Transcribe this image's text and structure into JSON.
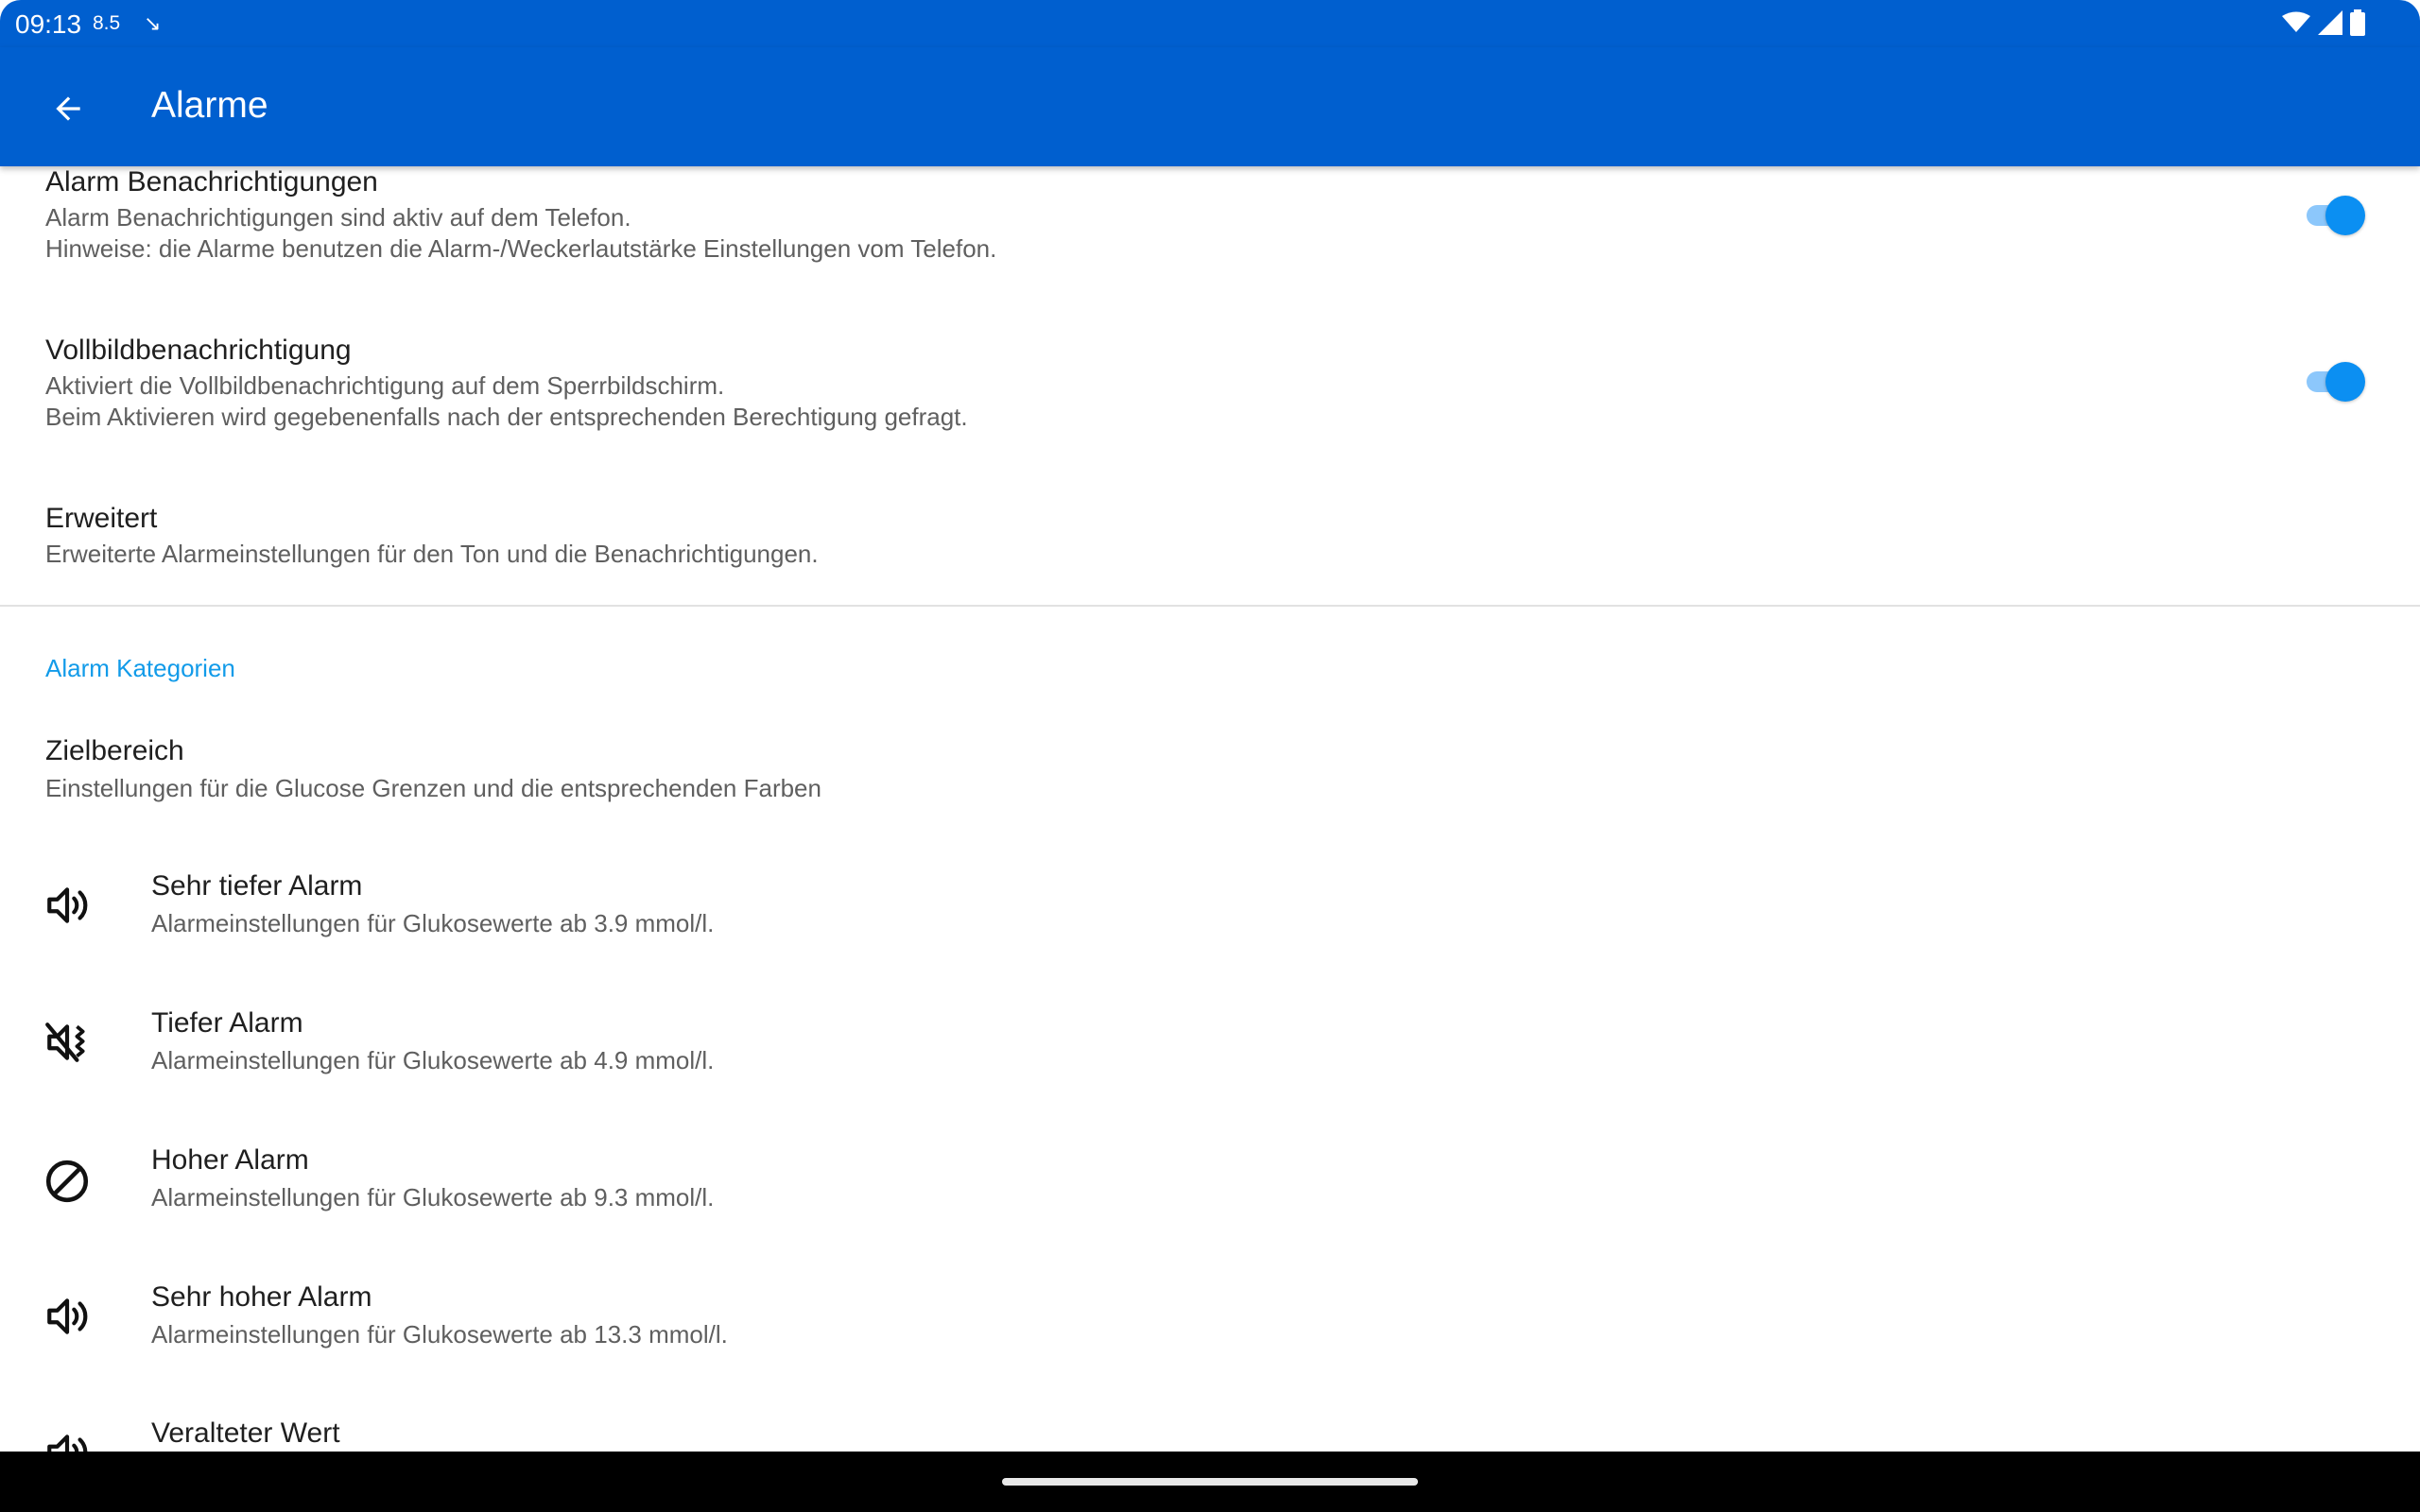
{
  "status_bar": {
    "time": "09:13",
    "value": "8.5",
    "trend_arrow": "↘",
    "icons": [
      "wifi-icon",
      "cellular-signal-icon",
      "battery-icon"
    ]
  },
  "app_bar": {
    "back_icon": "arrow-left-icon",
    "title": "Alarme"
  },
  "settings": {
    "alarm_notifications": {
      "title": "Alarm Benachrichtigungen",
      "summary_line1": "Alarm Benachrichtigungen sind aktiv auf dem Telefon.",
      "summary_line2": "Hinweise: die Alarme benutzen die Alarm-/Weckerlautstärke Einstellungen vom Telefon.",
      "enabled": true
    },
    "fullscreen_notification": {
      "title": "Vollbildbenachrichtigung",
      "summary_line1": "Aktiviert die Vollbildbenachrichtigung auf dem Sperrbildschirm.",
      "summary_line2": "Beim Aktivieren wird gegebenenfalls nach der entsprechenden Berechtigung gefragt.",
      "enabled": true
    },
    "advanced": {
      "title": "Erweitert",
      "summary": "Erweiterte Alarmeinstellungen für den Ton und die Benachrichtigungen."
    }
  },
  "categories": {
    "header": "Alarm Kategorien",
    "target_range": {
      "title": "Zielbereich",
      "summary": "Einstellungen für die Glucose Grenzen und die entsprechenden Farben"
    },
    "items": [
      {
        "title": "Sehr tiefer Alarm",
        "summary": "Alarmeinstellungen für Glukosewerte ab 3.9 mmol/l.",
        "icon": "volume-up-icon"
      },
      {
        "title": "Tiefer Alarm",
        "summary": "Alarmeinstellungen für Glukosewerte ab 4.9 mmol/l.",
        "icon": "vibrate-icon"
      },
      {
        "title": "Hoher Alarm",
        "summary": "Alarmeinstellungen für Glukosewerte ab 9.3 mmol/l.",
        "icon": "block-icon"
      },
      {
        "title": "Sehr hoher Alarm",
        "summary": "Alarmeinstellungen für Glukosewerte ab 13.3 mmol/l.",
        "icon": "volume-up-icon"
      },
      {
        "title": "Veralteter Wert",
        "icon": "volume-up-icon"
      }
    ]
  },
  "colors": {
    "primary": "#005fcf",
    "accent": "#0b8ff2",
    "section_header": "#129be9"
  }
}
